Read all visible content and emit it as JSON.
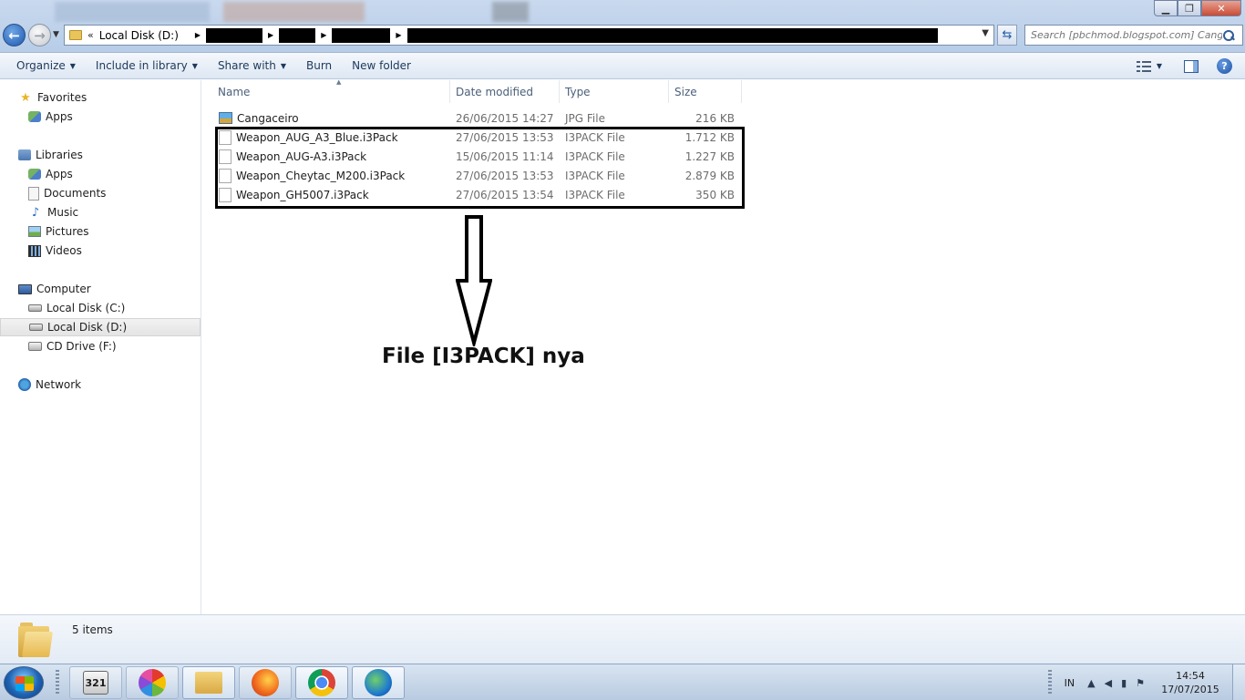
{
  "window": {
    "minimize_glyph": "▁",
    "maximize_glyph": "❐",
    "close_glyph": "✕"
  },
  "address": {
    "history_glyph": "«",
    "root": "Local Disk (D:)",
    "dropdown_glyph": "▼",
    "refresh_glyph": "⇆"
  },
  "search": {
    "placeholder": "Search [pbchmod.blogspot.com] Cang..."
  },
  "toolbar": {
    "organize": "Organize",
    "include_in_library": "Include in library",
    "share_with": "Share with",
    "burn": "Burn",
    "new_folder": "New folder",
    "help_glyph": "?"
  },
  "sidebar": {
    "favorites": "Favorites",
    "favorites_apps": "Apps",
    "libraries": "Libraries",
    "lib_apps": "Apps",
    "documents": "Documents",
    "music": "Music",
    "pictures": "Pictures",
    "videos": "Videos",
    "computer": "Computer",
    "disk_c": "Local Disk (C:)",
    "disk_d": "Local Disk (D:)",
    "cd_drive": "CD Drive (F:)",
    "network": "Network"
  },
  "columns": {
    "name": "Name",
    "date": "Date modified",
    "type": "Type",
    "size": "Size"
  },
  "files": [
    {
      "name": "Cangaceiro",
      "date": "26/06/2015 14:27",
      "type": "JPG File",
      "size": "216 KB"
    },
    {
      "name": "Weapon_AUG_A3_Blue.i3Pack",
      "date": "27/06/2015 13:53",
      "type": "I3PACK File",
      "size": "1.712 KB"
    },
    {
      "name": "Weapon_AUG-A3.i3Pack",
      "date": "15/06/2015 11:14",
      "type": "I3PACK File",
      "size": "1.227 KB"
    },
    {
      "name": "Weapon_Cheytac_M200.i3Pack",
      "date": "27/06/2015 13:53",
      "type": "I3PACK File",
      "size": "2.879 KB"
    },
    {
      "name": "Weapon_GH5007.i3Pack",
      "date": "27/06/2015 13:54",
      "type": "I3PACK File",
      "size": "350 KB"
    }
  ],
  "annotation": {
    "caption": "File [I3PACK] nya"
  },
  "details": {
    "item_count": "5 items"
  },
  "taskbar": {
    "app_321_label": "321",
    "lang": "IN",
    "time": "14:54",
    "date": "17/07/2015"
  }
}
